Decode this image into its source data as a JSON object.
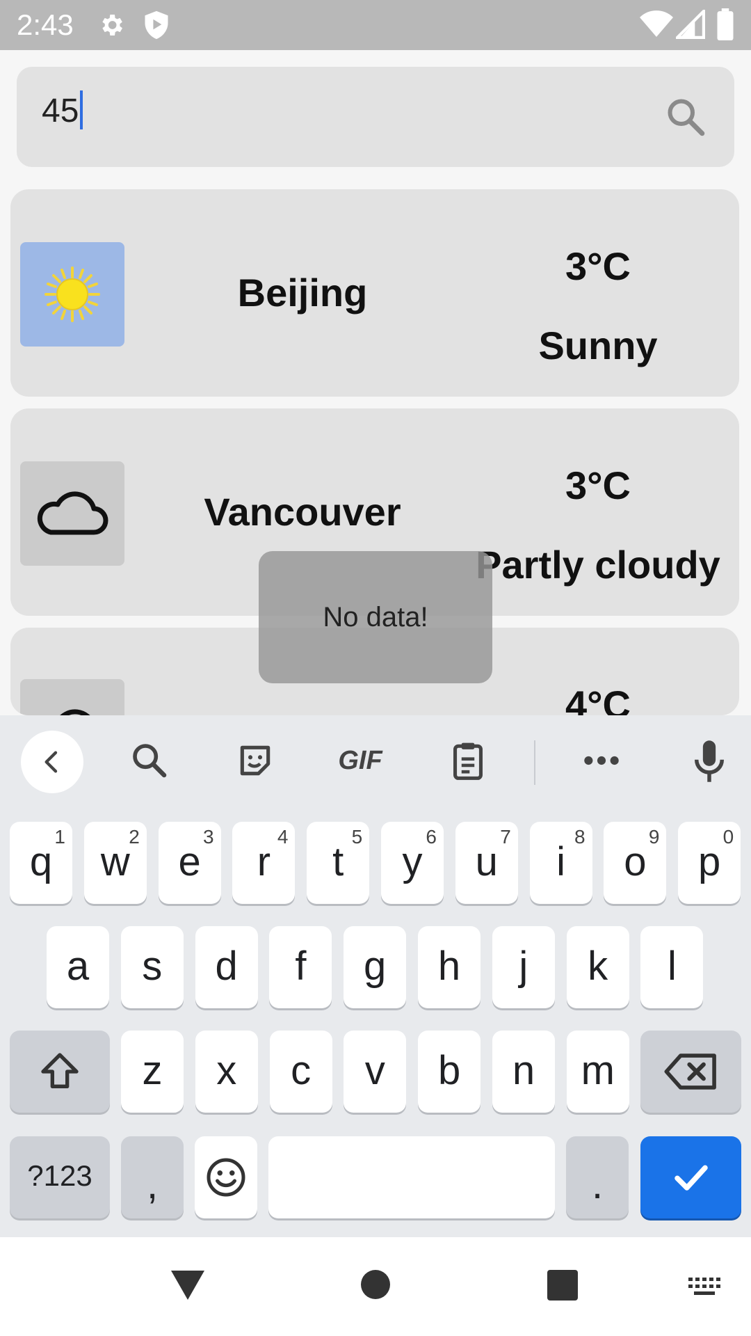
{
  "status_bar": {
    "time": "2:43"
  },
  "search": {
    "value": "45"
  },
  "cards": [
    {
      "city": "Beijing",
      "temp": "3°C",
      "condition": "Sunny",
      "icon": "sun-icon"
    },
    {
      "city": "Vancouver",
      "temp": "3°C",
      "condition": "Partly cloudy",
      "icon": "cloud-icon"
    },
    {
      "city": "",
      "temp": "4°C",
      "condition": "",
      "icon": "cloud-icon"
    }
  ],
  "toast": {
    "message": "No data!"
  },
  "keyboard": {
    "toolbar": [
      "back-icon",
      "search-icon",
      "sticker-icon",
      "GIF",
      "clipboard-icon",
      "more-icon",
      "mic-icon"
    ],
    "gif_label": "GIF",
    "row1": [
      {
        "k": "q",
        "h": "1"
      },
      {
        "k": "w",
        "h": "2"
      },
      {
        "k": "e",
        "h": "3"
      },
      {
        "k": "r",
        "h": "4"
      },
      {
        "k": "t",
        "h": "5"
      },
      {
        "k": "y",
        "h": "6"
      },
      {
        "k": "u",
        "h": "7"
      },
      {
        "k": "i",
        "h": "8"
      },
      {
        "k": "o",
        "h": "9"
      },
      {
        "k": "p",
        "h": "0"
      }
    ],
    "row2": [
      "a",
      "s",
      "d",
      "f",
      "g",
      "h",
      "j",
      "k",
      "l"
    ],
    "row3": [
      "z",
      "x",
      "c",
      "v",
      "b",
      "n",
      "m"
    ],
    "symbols_label": "?123",
    "comma_label": ",",
    "period_label": "."
  },
  "colors": {
    "accent": "#1a73e8",
    "status_bar": "#b8b8b8",
    "card": "#e2e2e2",
    "sunny_thumb": "#9db8e6"
  }
}
